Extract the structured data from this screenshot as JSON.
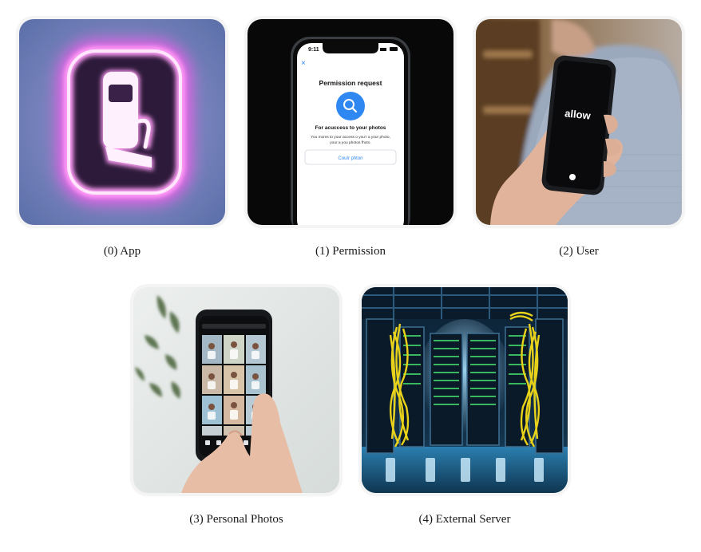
{
  "nodes": [
    {
      "index": 0,
      "caption": "(0) App",
      "icon": "neon-phone-app-icon"
    },
    {
      "index": 1,
      "caption": "(1) Permission",
      "icon": "phone-permission-dialog"
    },
    {
      "index": 2,
      "caption": "(2) User",
      "icon": "hand-holding-phone"
    },
    {
      "index": 3,
      "caption": "(3) Personal Photos",
      "icon": "phone-photo-gallery"
    },
    {
      "index": 4,
      "caption": "(4) External Server",
      "icon": "server-room"
    }
  ],
  "permission_screen": {
    "status_time": "9:11",
    "close_glyph": "×",
    "title": "Permission request",
    "heading": "For acuccess to your photos",
    "body_line1": "You moms to your access o you'r a your photo,",
    "body_line2": "your a you photos fhoto.",
    "button_label": "Coulr phton"
  },
  "user_phone": {
    "screen_text": "allow"
  },
  "colors": {
    "neon_pink": "#ff5cf0",
    "app_bg": "#6a78b4",
    "permission_blue": "#2f88f2",
    "server_cable": "#e8d21a"
  }
}
